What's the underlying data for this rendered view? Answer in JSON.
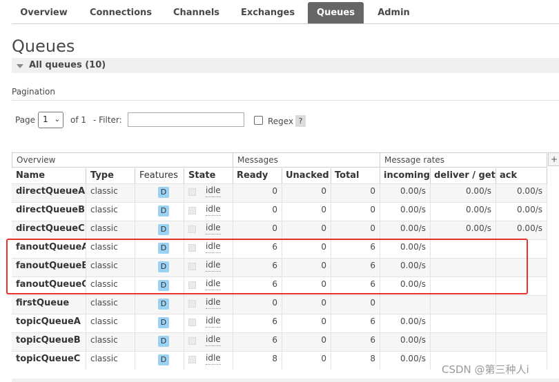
{
  "nav": {
    "tabs": [
      {
        "label": "Overview"
      },
      {
        "label": "Connections"
      },
      {
        "label": "Channels"
      },
      {
        "label": "Exchanges"
      },
      {
        "label": "Queues",
        "active": true
      },
      {
        "label": "Admin"
      }
    ]
  },
  "page": {
    "title": "Queues",
    "section_label": "All queues (10)",
    "pagination_label": "Pagination"
  },
  "filters": {
    "page_label": "Page",
    "page_value": "1",
    "of_label": "of 1",
    "filter_label": "- Filter:",
    "filter_value": "",
    "regex_label": "Regex",
    "regex_checked": false,
    "help_label": "?"
  },
  "table": {
    "groups": [
      "Overview",
      "Messages",
      "Message rates"
    ],
    "headers": [
      "Name",
      "Type",
      "Features",
      "State",
      "Ready",
      "Unacked",
      "Total",
      "incoming",
      "deliver / get",
      "ack"
    ],
    "add_column_label": "+",
    "rows": [
      {
        "name": "directQueueA",
        "type": "classic",
        "feature": "D",
        "state": "idle",
        "ready": "0",
        "unacked": "0",
        "total": "0",
        "incoming": "0.00/s",
        "deliver_get": "0.00/s",
        "ack": "0.00/s"
      },
      {
        "name": "directQueueB",
        "type": "classic",
        "feature": "D",
        "state": "idle",
        "ready": "0",
        "unacked": "0",
        "total": "0",
        "incoming": "0.00/s",
        "deliver_get": "0.00/s",
        "ack": "0.00/s"
      },
      {
        "name": "directQueueC",
        "type": "classic",
        "feature": "D",
        "state": "idle",
        "ready": "0",
        "unacked": "0",
        "total": "0",
        "incoming": "0.00/s",
        "deliver_get": "0.00/s",
        "ack": "0.00/s"
      },
      {
        "name": "fanoutQueueA",
        "type": "classic",
        "feature": "D",
        "state": "idle",
        "ready": "6",
        "unacked": "0",
        "total": "6",
        "incoming": "0.00/s",
        "deliver_get": "",
        "ack": ""
      },
      {
        "name": "fanoutQueueB",
        "type": "classic",
        "feature": "D",
        "state": "idle",
        "ready": "6",
        "unacked": "0",
        "total": "6",
        "incoming": "0.00/s",
        "deliver_get": "",
        "ack": ""
      },
      {
        "name": "fanoutQueueC",
        "type": "classic",
        "feature": "D",
        "state": "idle",
        "ready": "6",
        "unacked": "0",
        "total": "6",
        "incoming": "0.00/s",
        "deliver_get": "",
        "ack": ""
      },
      {
        "name": "firstQueue",
        "type": "classic",
        "feature": "D",
        "state": "idle",
        "ready": "0",
        "unacked": "0",
        "total": "0",
        "incoming": "",
        "deliver_get": "",
        "ack": ""
      },
      {
        "name": "topicQueueA",
        "type": "classic",
        "feature": "D",
        "state": "idle",
        "ready": "6",
        "unacked": "0",
        "total": "6",
        "incoming": "0.00/s",
        "deliver_get": "",
        "ack": ""
      },
      {
        "name": "topicQueueB",
        "type": "classic",
        "feature": "D",
        "state": "idle",
        "ready": "6",
        "unacked": "0",
        "total": "6",
        "incoming": "0.00/s",
        "deliver_get": "",
        "ack": ""
      },
      {
        "name": "topicQueueC",
        "type": "classic",
        "feature": "D",
        "state": "idle",
        "ready": "8",
        "unacked": "0",
        "total": "8",
        "incoming": "0.00/s",
        "deliver_get": "",
        "ack": ""
      }
    ]
  },
  "watermark": "CSDN @第三种人i",
  "colors": {
    "active_tab": "#666666",
    "feature_badge": "#9bd2f3",
    "highlight": "#e8312a"
  }
}
